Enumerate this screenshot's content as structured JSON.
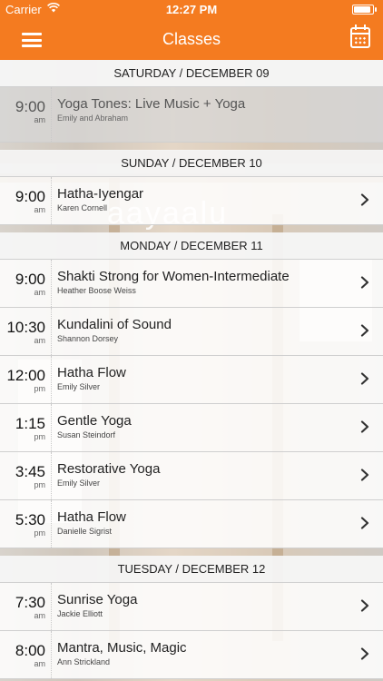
{
  "status_bar": {
    "carrier": "Carrier",
    "time": "12:27 PM",
    "battery_level": 0.95
  },
  "nav": {
    "title": "Classes"
  },
  "colors": {
    "accent": "#f47b20"
  },
  "icons": {
    "menu": "hamburger-icon",
    "calendar": "calendar-icon",
    "row_action": "chevron-right-icon"
  },
  "background_text": "aayaalu",
  "days": [
    {
      "header": "SATURDAY / DECEMBER 09",
      "classes": [
        {
          "time": "9:00",
          "ampm": "am",
          "name": "Yoga Tones: Live Music + Yoga",
          "teacher": "Emily and Abraham",
          "past": true
        }
      ]
    },
    {
      "header": "SUNDAY / DECEMBER 10",
      "classes": [
        {
          "time": "9:00",
          "ampm": "am",
          "name": "Hatha-Iyengar",
          "teacher": "Karen Cornell"
        }
      ]
    },
    {
      "header": "MONDAY / DECEMBER 11",
      "classes": [
        {
          "time": "9:00",
          "ampm": "am",
          "name": "Shakti Strong for Women-Intermediate",
          "teacher": "Heather Boose Weiss"
        },
        {
          "time": "10:30",
          "ampm": "am",
          "name": "Kundalini of Sound",
          "teacher": "Shannon Dorsey"
        },
        {
          "time": "12:00",
          "ampm": "pm",
          "name": "Hatha Flow",
          "teacher": "Emily Silver"
        },
        {
          "time": "1:15",
          "ampm": "pm",
          "name": "Gentle Yoga",
          "teacher": "Susan Steindorf"
        },
        {
          "time": "3:45",
          "ampm": "pm",
          "name": "Restorative Yoga",
          "teacher": "Emily Silver"
        },
        {
          "time": "5:30",
          "ampm": "pm",
          "name": "Hatha Flow",
          "teacher": "Danielle Sigrist"
        }
      ]
    },
    {
      "header": "TUESDAY / DECEMBER 12",
      "classes": [
        {
          "time": "7:30",
          "ampm": "am",
          "name": "Sunrise Yoga",
          "teacher": "Jackie Elliott"
        },
        {
          "time": "8:00",
          "ampm": "am",
          "name": "Mantra, Music, Magic",
          "teacher": "Ann Strickland"
        }
      ]
    }
  ]
}
